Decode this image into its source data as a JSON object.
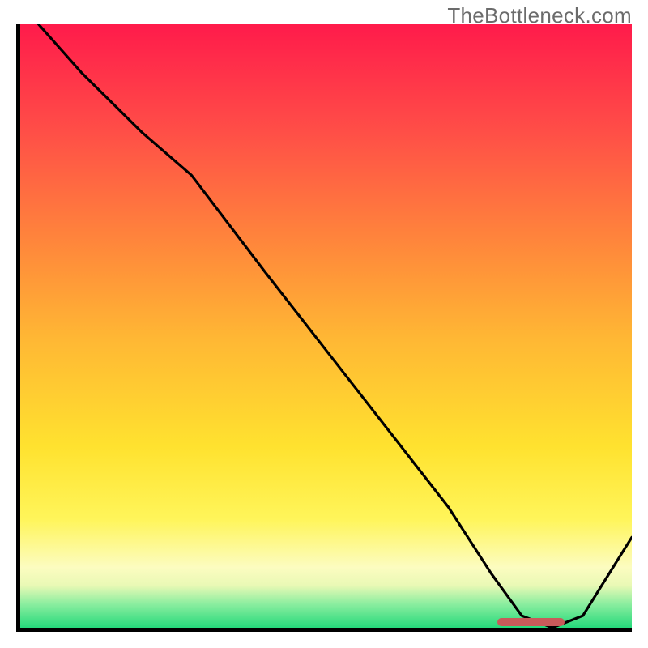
{
  "watermark": "TheBottleneck.com",
  "colors": {
    "gradient_top": "#ff1b4b",
    "gradient_mid1": "#ff8c3a",
    "gradient_mid2": "#ffe22f",
    "gradient_bottom": "#25d97b",
    "curve": "#000000",
    "marker": "#c95a5a",
    "axis": "#000000"
  },
  "chart_data": {
    "type": "line",
    "title": "",
    "xlabel": "",
    "ylabel": "",
    "xlim": [
      0,
      100
    ],
    "ylim": [
      0,
      100
    ],
    "series": [
      {
        "name": "curve",
        "x": [
          3,
          10,
          20,
          28,
          40,
          50,
          60,
          70,
          77,
          82,
          87,
          92,
          100
        ],
        "values": [
          100,
          92,
          82,
          75,
          59,
          46,
          33,
          20,
          9,
          2,
          0,
          2,
          15
        ]
      }
    ],
    "marker": {
      "x_start": 78,
      "x_end": 89,
      "y": 1
    },
    "background_gradient": {
      "direction": "vertical",
      "stops": [
        {
          "pos": 0.0,
          "color": "#ff1b4b"
        },
        {
          "pos": 0.18,
          "color": "#ff4f47"
        },
        {
          "pos": 0.38,
          "color": "#ff8c3a"
        },
        {
          "pos": 0.52,
          "color": "#ffb734"
        },
        {
          "pos": 0.7,
          "color": "#ffe22f"
        },
        {
          "pos": 0.82,
          "color": "#fff55a"
        },
        {
          "pos": 0.9,
          "color": "#fcfcc0"
        },
        {
          "pos": 0.93,
          "color": "#e9f9b5"
        },
        {
          "pos": 0.96,
          "color": "#8deea0"
        },
        {
          "pos": 1.0,
          "color": "#25d97b"
        }
      ]
    }
  }
}
